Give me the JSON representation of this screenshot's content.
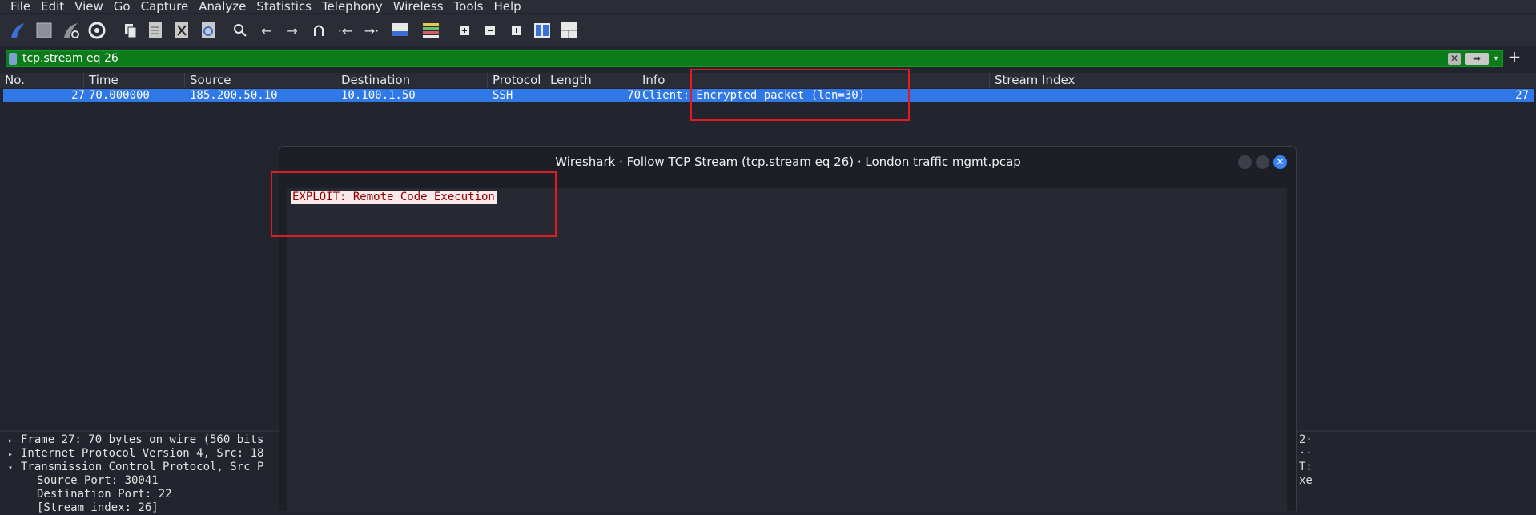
{
  "menu": [
    "File",
    "Edit",
    "View",
    "Go",
    "Capture",
    "Analyze",
    "Statistics",
    "Telephony",
    "Wireless",
    "Tools",
    "Help"
  ],
  "filter": {
    "value": "tcp.stream eq 26"
  },
  "columns": [
    "No.",
    "Time",
    "Source",
    "Destination",
    "Protocol",
    "Length",
    "Info",
    "Stream Index"
  ],
  "packet": {
    "no": "27",
    "time": "70.000000",
    "source": "185.200.50.10",
    "destination": "10.100.1.50",
    "protocol": "SSH",
    "length": "70",
    "info": "Client: Encrypted packet (len=30)",
    "stream_index": "27"
  },
  "details": {
    "frame": "Frame 27: 70 bytes on wire (560 bits",
    "ip": "Internet Protocol Version 4, Src: 18",
    "tcp": "Transmission Control Protocol, Src P",
    "src_port": "Source Port: 30041",
    "dst_port": "Destination Port: 22",
    "stream_index": "[Stream index: 26]"
  },
  "details_right": [
    "2·",
    "··",
    "T:",
    "xe"
  ],
  "dialog": {
    "title": "Wireshark · Follow TCP Stream (tcp.stream eq 26) · London traffic mgmt.pcap",
    "stream_text": "EXPLOIT: Remote Code Execution"
  },
  "colors": {
    "selection": "#2f78e6",
    "filter_ok": "#0c7b1a",
    "highlight_box": "#e01b24"
  }
}
